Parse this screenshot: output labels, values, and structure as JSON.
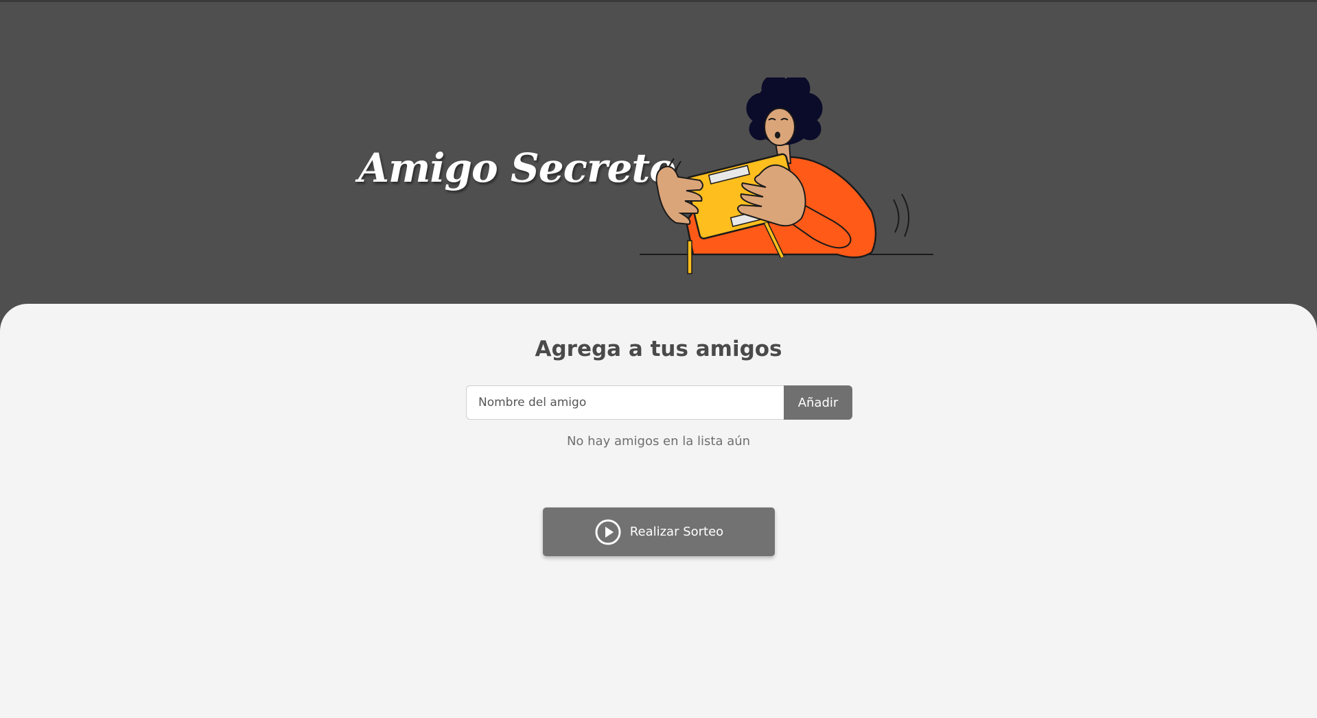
{
  "header": {
    "title": "Amigo Secreto",
    "illustration_icon": "person-opening-gift-icon"
  },
  "main": {
    "section_title": "Agrega a tus amigos",
    "name_input": {
      "placeholder": "Nombre del amigo",
      "value": ""
    },
    "add_button_label": "Añadir",
    "empty_list_message": "No hay amigos en la lista aún",
    "draw_button": {
      "label": "Realizar Sorteo",
      "icon": "play-circle-icon"
    }
  },
  "colors": {
    "header_bg": "#4f4f4f",
    "panel_bg": "#f4f4f4",
    "button_bg": "#707070",
    "accent_orange": "#ff5a17",
    "accent_yellow": "#fdbe1e"
  }
}
